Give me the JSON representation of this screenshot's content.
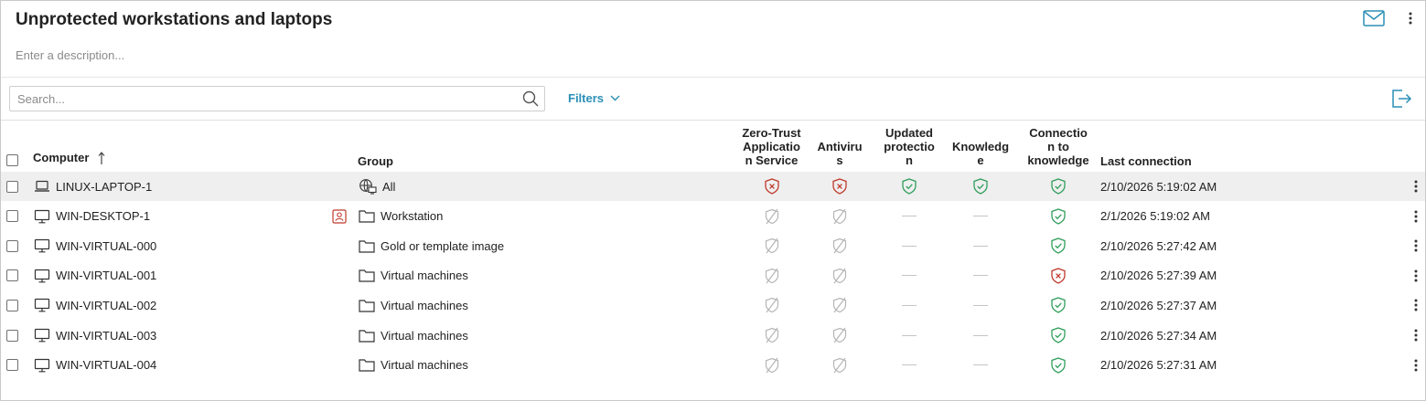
{
  "header": {
    "title": "Unprotected workstations and laptops",
    "description_placeholder": "Enter a description..."
  },
  "toolbar": {
    "search_placeholder": "Search...",
    "filters_label": "Filters"
  },
  "columns": {
    "computer": "Computer",
    "group": "Group",
    "zero_trust": [
      "Zero-Trust",
      "Applicatio",
      "n Service"
    ],
    "antivirus": [
      "Antiviru",
      "s"
    ],
    "updated_protection": [
      "Updated",
      "protectio",
      "n"
    ],
    "knowledge": [
      "Knowledg",
      "e"
    ],
    "connection_to_knowledge": [
      "Connectio",
      "n to",
      "knowledge"
    ],
    "last_connection": "Last connection"
  },
  "rows": [
    {
      "computer": "LINUX-LAPTOP-1",
      "device": "laptop-icon",
      "group": "All",
      "group_icon": "network-group-icon",
      "alert": false,
      "zero_trust": "error",
      "antivirus": "error",
      "updated": "ok",
      "knowledge": "ok",
      "connection": "ok",
      "last_connection": "2/10/2026 5:19:02 AM",
      "selected": true
    },
    {
      "computer": "WIN-DESKTOP-1",
      "device": "desktop-icon",
      "group": "Workstation",
      "group_icon": "folder-icon",
      "alert": true,
      "zero_trust": "na",
      "antivirus": "na",
      "updated": "none",
      "knowledge": "none",
      "connection": "ok",
      "last_connection": "2/1/2026 5:19:02 AM",
      "selected": false
    },
    {
      "computer": "WIN-VIRTUAL-000",
      "device": "desktop-icon",
      "group": "Gold or template image",
      "group_icon": "folder-icon",
      "alert": false,
      "zero_trust": "na",
      "antivirus": "na",
      "updated": "none",
      "knowledge": "none",
      "connection": "ok",
      "last_connection": "2/10/2026 5:27:42 AM",
      "selected": false
    },
    {
      "computer": "WIN-VIRTUAL-001",
      "device": "desktop-icon",
      "group": "Virtual machines",
      "group_icon": "folder-icon",
      "alert": false,
      "zero_trust": "na",
      "antivirus": "na",
      "updated": "none",
      "knowledge": "none",
      "connection": "error",
      "last_connection": "2/10/2026 5:27:39 AM",
      "selected": false
    },
    {
      "computer": "WIN-VIRTUAL-002",
      "device": "desktop-icon",
      "group": "Virtual machines",
      "group_icon": "folder-icon",
      "alert": false,
      "zero_trust": "na",
      "antivirus": "na",
      "updated": "none",
      "knowledge": "none",
      "connection": "ok",
      "last_connection": "2/10/2026 5:27:37 AM",
      "selected": false
    },
    {
      "computer": "WIN-VIRTUAL-003",
      "device": "desktop-icon",
      "group": "Virtual machines",
      "group_icon": "folder-icon",
      "alert": false,
      "zero_trust": "na",
      "antivirus": "na",
      "updated": "none",
      "knowledge": "none",
      "connection": "ok",
      "last_connection": "2/10/2026 5:27:34 AM",
      "selected": false
    },
    {
      "computer": "WIN-VIRTUAL-004",
      "device": "desktop-icon",
      "group": "Virtual machines",
      "group_icon": "folder-icon",
      "alert": false,
      "zero_trust": "na",
      "antivirus": "na",
      "updated": "none",
      "knowledge": "none",
      "connection": "ok",
      "last_connection": "2/10/2026 5:27:31 AM",
      "selected": false
    }
  ],
  "colors": {
    "accent": "#2a8fb5",
    "ok": "#2f9e5b",
    "error": "#c0392b",
    "na": "#b5b5b5",
    "selected_row": "#efefef"
  }
}
